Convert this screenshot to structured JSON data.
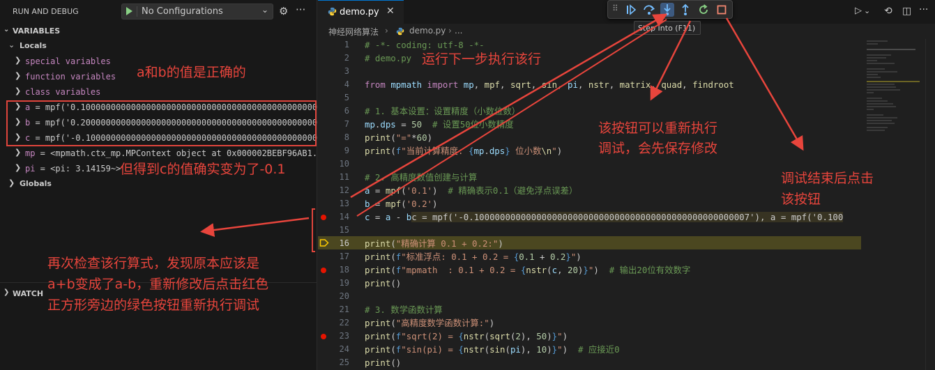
{
  "sidebar": {
    "title": "RUN AND DEBUG",
    "config_select": "No Configurations",
    "variables_title": "VARIABLES",
    "locals_label": "Locals",
    "groups": [
      "special variables",
      "function variables",
      "class variables"
    ],
    "vars": [
      {
        "name": "a",
        "value": "mpf('0.10000000000000000000000000000000000000000000000000",
        "trunc": "..."
      },
      {
        "name": "b",
        "value": "mpf('0.20000000000000000000000000000000000000000000000000",
        "trunc": "..."
      },
      {
        "name": "c",
        "value": "mpf('-0.1000000000000000000000000000000000000000000000000",
        "trunc": "..."
      },
      {
        "name": "mp",
        "value": "<mpmath.ctx_mp.MPContext object at 0x000002BEBF96AB1",
        "trunc": "..."
      },
      {
        "name": "pi",
        "value": "<pi: 3.14159~>",
        "trunc": ""
      }
    ],
    "globals_label": "Globals",
    "watch_title": "WATCH"
  },
  "editor": {
    "tab_label": "demo.py",
    "breadcrumb": [
      "神经网络算法",
      "demo.py",
      "..."
    ],
    "tooltip": "Step Into (F11)",
    "lines": [
      {
        "n": "1"
      },
      {
        "n": "2"
      },
      {
        "n": "3"
      },
      {
        "n": "4"
      },
      {
        "n": "5"
      },
      {
        "n": "6"
      },
      {
        "n": "7"
      },
      {
        "n": "8"
      },
      {
        "n": "9"
      },
      {
        "n": "10"
      },
      {
        "n": "11"
      },
      {
        "n": "12"
      },
      {
        "n": "13"
      },
      {
        "n": "14"
      },
      {
        "n": "15"
      },
      {
        "n": "16"
      },
      {
        "n": "17"
      },
      {
        "n": "18"
      },
      {
        "n": "19"
      },
      {
        "n": "20"
      },
      {
        "n": "21"
      },
      {
        "n": "22"
      },
      {
        "n": "23"
      },
      {
        "n": "24"
      },
      {
        "n": "25"
      }
    ],
    "breakpoint_lines": [
      "14",
      "18",
      "23"
    ],
    "current_line": "16"
  },
  "annotations": {
    "a1": "运行下一步执行该行",
    "a2": "a和b的值是正确的",
    "a3": "但得到c的值确实变为了-0.1",
    "a4_l1": "该按钮可以重新执行",
    "a4_l2": "调试，会先保存修改",
    "a5_l1": "调试结束后点击",
    "a5_l2": "该按钮",
    "a6_l1": "再次检查该行算式，发现原本应该是",
    "a6_l2": "a+b变成了a-b，重新修改后点击红色",
    "a6_l3": "正方形旁边的绿色按钮重新执行调试"
  },
  "colors": {
    "annotation": "#e8453c",
    "breakpoint": "#e51400",
    "current_line_bg": "#4b4720",
    "restart": "#89d185",
    "step": "#75beff",
    "stop": "#f48771"
  },
  "icons": [
    "play-icon",
    "chevron-down-icon",
    "gear-icon",
    "more-icon",
    "python-file-icon",
    "close-icon",
    "continue-icon",
    "step-over-icon",
    "step-into-icon",
    "step-out-icon",
    "restart-icon",
    "stop-icon",
    "run-icon",
    "timeline-icon",
    "split-editor-icon"
  ]
}
